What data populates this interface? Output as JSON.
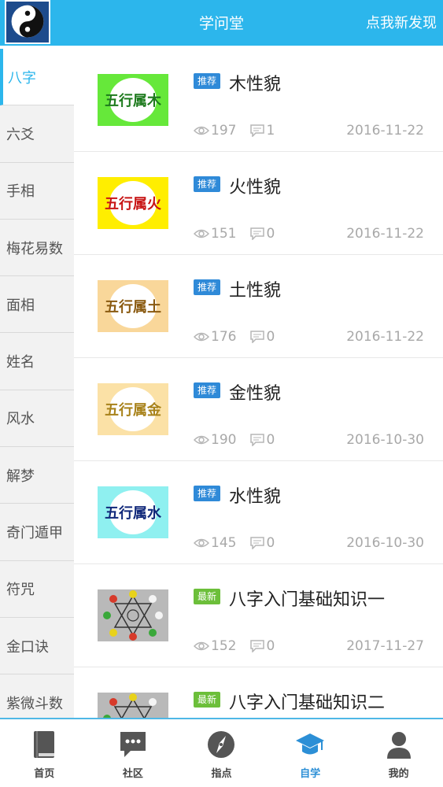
{
  "header": {
    "title": "学问堂",
    "action_label": "点我新发现"
  },
  "sidebar": {
    "items": [
      {
        "label": "八字",
        "active": true
      },
      {
        "label": "六爻"
      },
      {
        "label": "手相"
      },
      {
        "label": "梅花易数"
      },
      {
        "label": "面相"
      },
      {
        "label": "姓名"
      },
      {
        "label": "风水"
      },
      {
        "label": "解梦"
      },
      {
        "label": "奇门遁甲"
      },
      {
        "label": "符咒"
      },
      {
        "label": "金口诀"
      },
      {
        "label": "紫微斗数"
      }
    ]
  },
  "articles": [
    {
      "badge": "推荐",
      "title": "木性貌",
      "views": "197",
      "comments": "1",
      "date": "2016-11-22",
      "thumb_text": "五行属木",
      "thumb_bg": "#66e83a",
      "thumb_fg": "#1d7a1d"
    },
    {
      "badge": "推荐",
      "title": "火性貌",
      "views": "151",
      "comments": "0",
      "date": "2016-11-22",
      "thumb_text": "五行属火",
      "thumb_bg": "#ffee00",
      "thumb_fg": "#c81515"
    },
    {
      "badge": "推荐",
      "title": "土性貌",
      "views": "176",
      "comments": "0",
      "date": "2016-11-22",
      "thumb_text": "五行属土",
      "thumb_bg": "#f9d79a",
      "thumb_fg": "#8a5a10"
    },
    {
      "badge": "推荐",
      "title": "金性貌",
      "views": "190",
      "comments": "0",
      "date": "2016-10-30",
      "thumb_text": "五行属金",
      "thumb_bg": "#fbe1a6",
      "thumb_fg": "#a8821a"
    },
    {
      "badge": "推荐",
      "title": "水性貌",
      "views": "145",
      "comments": "0",
      "date": "2016-10-30",
      "thumb_text": "五行属水",
      "thumb_bg": "#8ff0f0",
      "thumb_fg": "#10287a"
    },
    {
      "badge": "最新",
      "title": "八字入门基础知识一",
      "views": "152",
      "comments": "0",
      "date": "2017-11-27",
      "thumb_text": "",
      "thumb_bg": "#b9b9b9",
      "thumb_fg": "#333333"
    },
    {
      "badge": "最新",
      "title": "八字入门基础知识二",
      "views": "",
      "comments": "",
      "date": "",
      "thumb_text": "",
      "thumb_bg": "#b9b9b9",
      "thumb_fg": "#333333"
    }
  ],
  "tabs": [
    {
      "label": "首页",
      "icon": "book-icon"
    },
    {
      "label": "社区",
      "icon": "chat-icon"
    },
    {
      "label": "指点",
      "icon": "compass-icon"
    },
    {
      "label": "自学",
      "icon": "graduation-cap-icon",
      "active": true
    },
    {
      "label": "我的",
      "icon": "person-icon"
    }
  ],
  "colors": {
    "accent": "#2cb6ec",
    "badge_recommend": "#2f8ad8",
    "badge_new": "#6cbf3a"
  }
}
